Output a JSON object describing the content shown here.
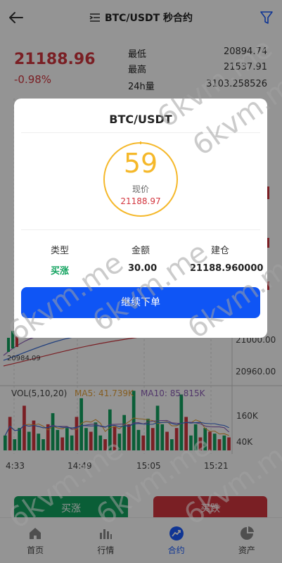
{
  "header": {
    "title": "BTC/USDT 秒合约"
  },
  "ticker": {
    "last_price": "21188.96",
    "change_pct": "-0.98%",
    "stats": [
      {
        "label": "最低",
        "value": "20894.74"
      },
      {
        "label": "最高",
        "value": "21537.91"
      },
      {
        "label": "24h量",
        "value": "3103.258526"
      }
    ]
  },
  "chart_data": {
    "type": "candlestick",
    "price_axis_ticks": [
      "21000.00",
      "20960.00"
    ],
    "min_marker": "20984.09",
    "volume_axis_ticks": [
      "160K",
      "40K"
    ],
    "time_ticks": [
      "4:33",
      "14:49",
      "15:05",
      "15:21"
    ],
    "volume_legend": {
      "label": "VOL(5,10,20)",
      "ma5": "MA5: 41.739K",
      "ma10": "MA10: 85.815K"
    },
    "volume_values": [
      40,
      90,
      30,
      60,
      120,
      50,
      80,
      45,
      30,
      70,
      100,
      55,
      35,
      60,
      40,
      90,
      140,
      60,
      50,
      75,
      40,
      30,
      110,
      65,
      45,
      95,
      70,
      160,
      55,
      40,
      85,
      60,
      120,
      70,
      50,
      30,
      60,
      150,
      90,
      40,
      70,
      35,
      60,
      50,
      45,
      30,
      40,
      35
    ],
    "volume_up": [
      1,
      0,
      1,
      1,
      0,
      1,
      0,
      1,
      1,
      0,
      1,
      1,
      0,
      1,
      1,
      0,
      1,
      1,
      0,
      1,
      1,
      0,
      1,
      0,
      1,
      1,
      0,
      1,
      1,
      0,
      1,
      0,
      1,
      1,
      0,
      1,
      0,
      1,
      0,
      1,
      1,
      0,
      1,
      0,
      1,
      0,
      1,
      0
    ],
    "colors": {
      "up": "#12a35f",
      "down": "#d3363f",
      "ma5": "#e6a23c",
      "ma10": "#8e5fb8",
      "ma_line3": "#d3363f",
      "ma_line4": "#3b6fd9"
    }
  },
  "buttons": {
    "buy_up": "买涨",
    "buy_down": "买跌"
  },
  "nav": [
    {
      "label": "首页",
      "icon": "home-icon"
    },
    {
      "label": "行情",
      "icon": "bar-chart-icon"
    },
    {
      "label": "合约",
      "icon": "trend-icon",
      "active": true
    },
    {
      "label": "资产",
      "icon": "pie-chart-icon"
    }
  ],
  "modal": {
    "title": "BTC/USDT",
    "countdown": "59",
    "now_label": "现价",
    "now_price": "21188.97",
    "headers": [
      "类型",
      "金额",
      "建仓"
    ],
    "values": [
      "买涨",
      "30.00",
      "21188.960000"
    ],
    "confirm_label": "继续下单"
  },
  "watermark": "6kvm.me",
  "accent": {
    "blue": "#0f55f5",
    "green": "#12a35f",
    "red": "#d3363f",
    "yellow": "#f5b82a"
  }
}
